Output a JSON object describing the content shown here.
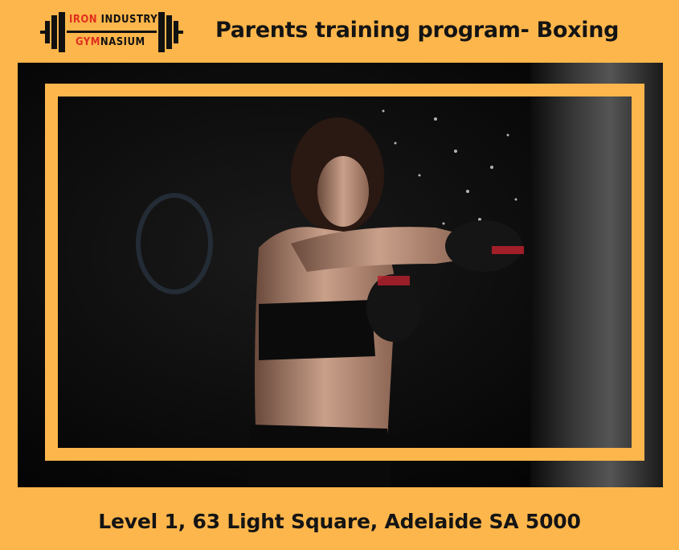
{
  "logo": {
    "line1_a": "IRON",
    "line1_b": "INDUSTRY",
    "line2_a": "GYM",
    "line2_b": "NASIUM",
    "icon": "barbell-icon"
  },
  "headline": "Parents training program- Boxing",
  "photo": {
    "icon": "boxer-punching-bag-photo"
  },
  "address": "Level 1, 63 Light Square, Adelaide SA 5000",
  "colors": {
    "background": "#fdb64b",
    "frame": "#fdb64b",
    "photo_bg": "#050505",
    "logo_red": "#e02f1f",
    "text": "#141414"
  }
}
